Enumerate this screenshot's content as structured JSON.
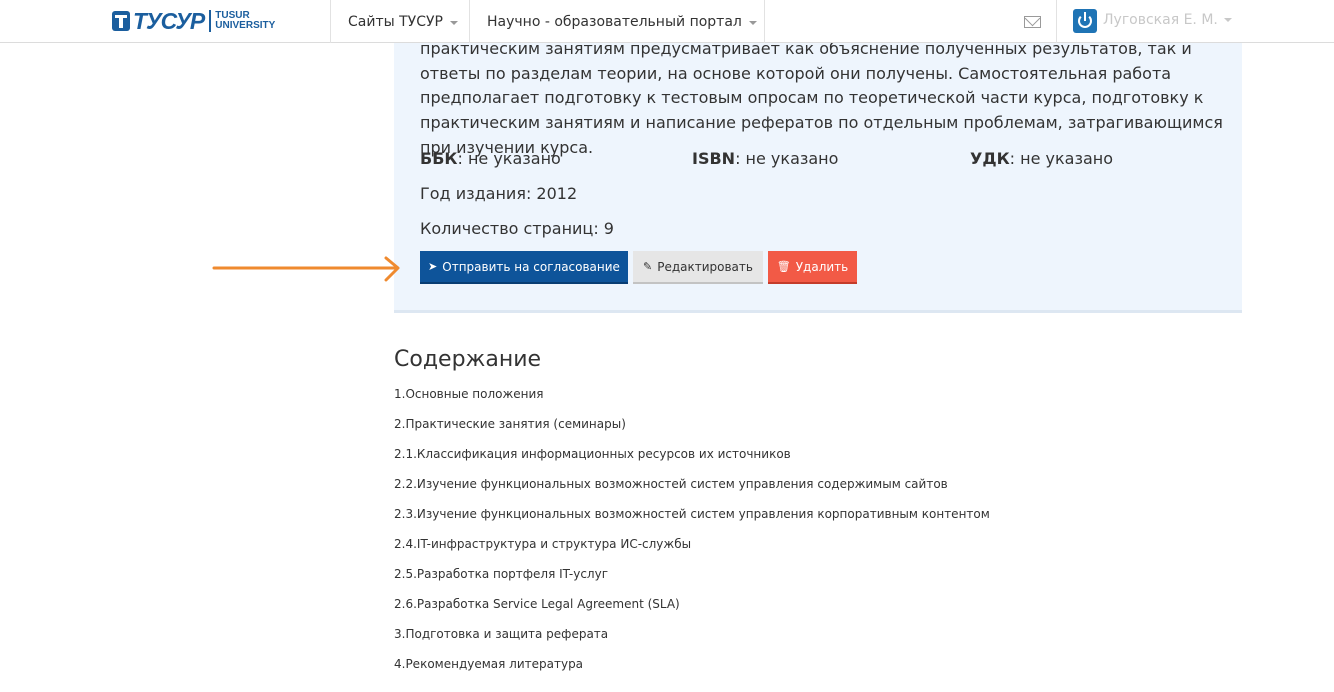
{
  "navbar": {
    "logo_word": "ТУСУР",
    "logo_sub_line1": "TUSUR",
    "logo_sub_line2": "UNIVERSITY",
    "sites_label": "Сайты ТУСУР",
    "portal_label": "Научно - образовательный портал",
    "user_name": "Луговская Е. М.",
    "icons": [
      "mail-icon",
      "power-icon",
      "chevron-down-icon"
    ]
  },
  "publication": {
    "description": "практическим занятиям предусматривает как объяснение полученных результатов, так и ответы по разделам теории, на основе которой они получены. Самостоятельная работа предполагает подготовку к тестовым опросам по теоретической части курса, подготовку к практическим занятиям и написание рефератов по отдельным проблемам, затрагивающимся при изучении курса.",
    "bbk_label": "ББК",
    "bbk_value": ": не указано",
    "isbn_label": "ISBN",
    "isbn_value": ": не указано",
    "udk_label": "УДК",
    "udk_value": ": не указано",
    "year_line": "Год издания: 2012",
    "pages_line": "Количество страниц: 9"
  },
  "buttons": {
    "send_label": "Отправить на согласование",
    "edit_label": "Редактировать",
    "delete_label": "Удалить"
  },
  "colors": {
    "send_button": "#0e549a",
    "delete_button": "#f25a46",
    "panel_bg": "#eef5fd",
    "arrow": "#ef8a2f",
    "brand": "#1b5e9e"
  },
  "contents": {
    "title": "Содержание",
    "items": [
      "1.Основные положения",
      "2.Практические занятия (семинары)",
      "2.1.Классификация информационных ресурсов их источников",
      "2.2.Изучение функциональных возможностей систем управления содержимым сайтов",
      "2.3.Изучение функциональных возможностей систем управления корпоративным контентом",
      "2.4.IT-инфраструктура и структура ИС-службы",
      "2.5.Разработка портфеля IT-услуг",
      "2.6.Разработка Service Legal Agreement (SLA)",
      "3.Подготовка и защита реферата",
      "4.Рекомендуемая литература"
    ]
  }
}
